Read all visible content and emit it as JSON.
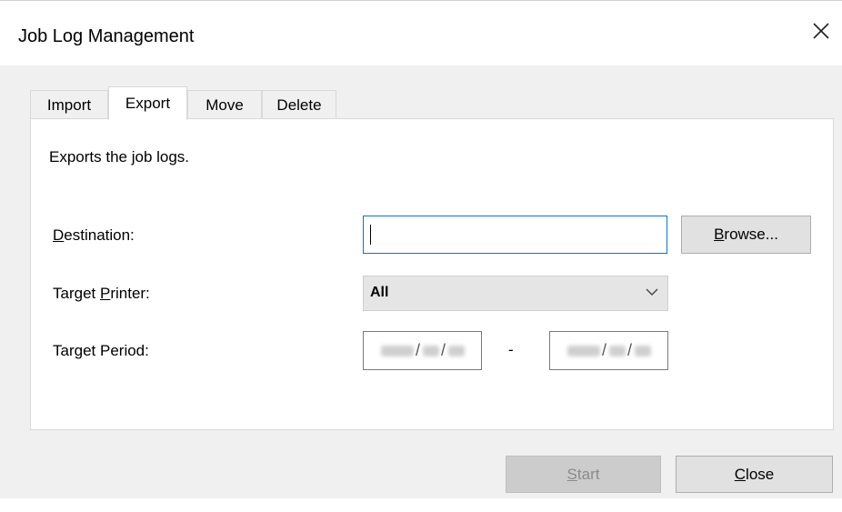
{
  "window": {
    "title": "Job Log Management",
    "close_glyph": "✕"
  },
  "tabs": [
    {
      "label": "Import"
    },
    {
      "label": "Export"
    },
    {
      "label": "Move"
    },
    {
      "label": "Delete"
    }
  ],
  "active_tab": "Export",
  "panel": {
    "description": "Exports the job logs.",
    "destination": {
      "label_mnemonic": "D",
      "label_rest": "estination:",
      "value": ""
    },
    "browse_button": {
      "mnemonic": "B",
      "rest": "rowse..."
    },
    "target_printer": {
      "label_pre": "Target ",
      "label_mnemonic": "P",
      "label_rest": "rinter:",
      "value": "All"
    },
    "target_period": {
      "label_pre": "Tar",
      "label_mnemonic": "g",
      "label_rest": "et Period:",
      "separator": "-",
      "date_separator": "/"
    }
  },
  "footer": {
    "start_button": {
      "mnemonic": "S",
      "rest": "tart",
      "enabled": false
    },
    "close_button": {
      "mnemonic": "C",
      "rest": "lose"
    }
  },
  "colors": {
    "focus_border": "#0078d7",
    "window_bg": "#f0f0f0",
    "panel_bg": "#ffffff"
  },
  "icons": {
    "close": "close-icon",
    "dropdown": "chevron-down-icon"
  }
}
